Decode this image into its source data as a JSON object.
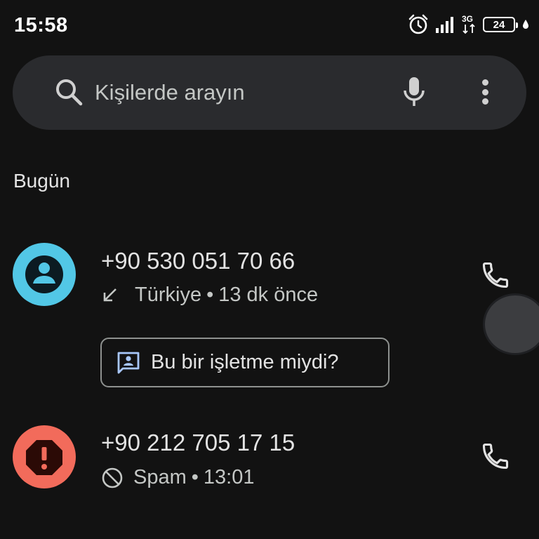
{
  "status_bar": {
    "time": "15:58",
    "battery_level": "24",
    "network_type": "3G",
    "icons": [
      "alarm-icon",
      "signal-icon",
      "network-3g-icon",
      "battery-icon",
      "charging-icon"
    ]
  },
  "search": {
    "placeholder": "Kişilerde arayın",
    "icons": [
      "search-icon",
      "mic-icon",
      "more-vert-icon"
    ]
  },
  "section": {
    "title": "Bugün"
  },
  "calls": [
    {
      "number": "+90 530 051 70 66",
      "location": "Türkiye",
      "separator": "•",
      "time": "13 dk önce",
      "direction_icon": "incoming-call-arrow-icon",
      "avatar_icon": "person-icon",
      "avatar_color": "#52c7e6",
      "chip_label": "Bu bir işletme miydi?",
      "chip_icon": "business-feedback-icon"
    },
    {
      "number": "+90 212 705 17 15",
      "location": "Spam",
      "separator": "•",
      "time": "13:01",
      "direction_icon": "blocked-icon",
      "avatar_icon": "spam-warning-icon",
      "avatar_color": "#f26b5b"
    }
  ],
  "colors": {
    "background": "#121212",
    "search_bar": "#2a2b2e",
    "text_primary": "#e3e3e3",
    "text_secondary": "#c4c7c5",
    "chip_icon": "#a8c7fa"
  }
}
